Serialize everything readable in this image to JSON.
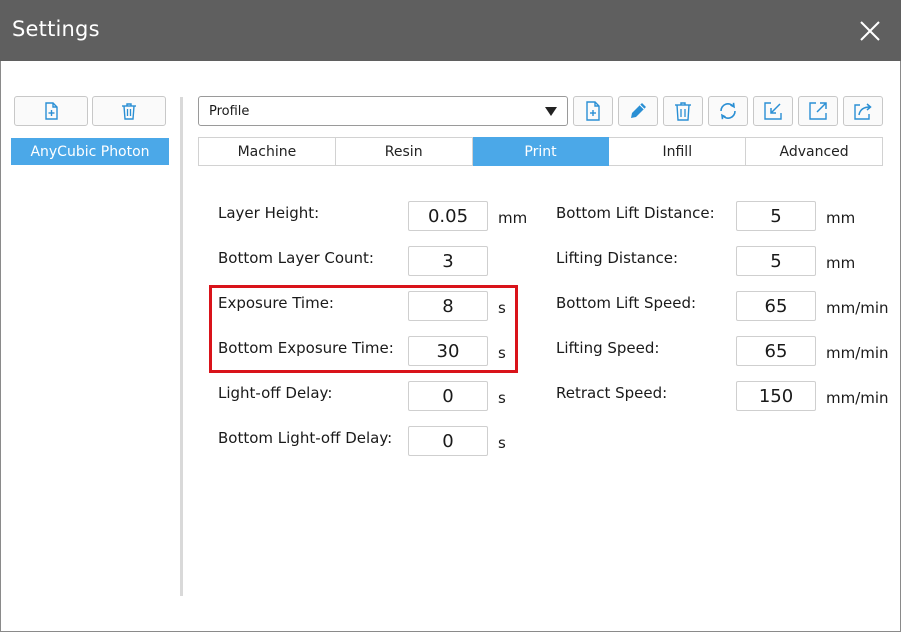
{
  "window": {
    "title": "Settings",
    "close_icon": "close-icon"
  },
  "left_panel": {
    "add_icon": "file-add-icon",
    "delete_icon": "trash-icon",
    "machine_name": "AnyCubic Photon"
  },
  "profile": {
    "selected": "Profile"
  },
  "toolbar": {
    "icons": [
      "file-add-icon",
      "pencil-icon",
      "trash-icon",
      "refresh-icon",
      "import-icon",
      "export-icon",
      "share-icon"
    ]
  },
  "tabs": [
    "Machine",
    "Resin",
    "Print",
    "Infill",
    "Advanced"
  ],
  "active_tab": "Print",
  "left_fields": [
    {
      "label": "Layer Height:",
      "value": "0.05",
      "unit": "mm"
    },
    {
      "label": "Bottom Layer Count:",
      "value": "3",
      "unit": ""
    },
    {
      "label": "Exposure Time:",
      "value": "8",
      "unit": "s"
    },
    {
      "label": "Bottom Exposure Time:",
      "value": "30",
      "unit": "s"
    },
    {
      "label": "Light-off Delay:",
      "value": "0",
      "unit": "s"
    },
    {
      "label": "Bottom Light-off Delay:",
      "value": "0",
      "unit": "s"
    }
  ],
  "right_fields": [
    {
      "label": "Bottom Lift Distance:",
      "value": "5",
      "unit": "mm"
    },
    {
      "label": "Lifting Distance:",
      "value": "5",
      "unit": "mm"
    },
    {
      "label": "Bottom Lift Speed:",
      "value": "65",
      "unit": "mm/min"
    },
    {
      "label": "Lifting Speed:",
      "value": "65",
      "unit": "mm/min"
    },
    {
      "label": "Retract Speed:",
      "value": "150",
      "unit": "mm/min"
    }
  ],
  "colors": {
    "titlebar": "#5f5f5f",
    "accent": "#4ba8e8",
    "highlight": "#d9131a",
    "icon": "#2a8fd4"
  }
}
